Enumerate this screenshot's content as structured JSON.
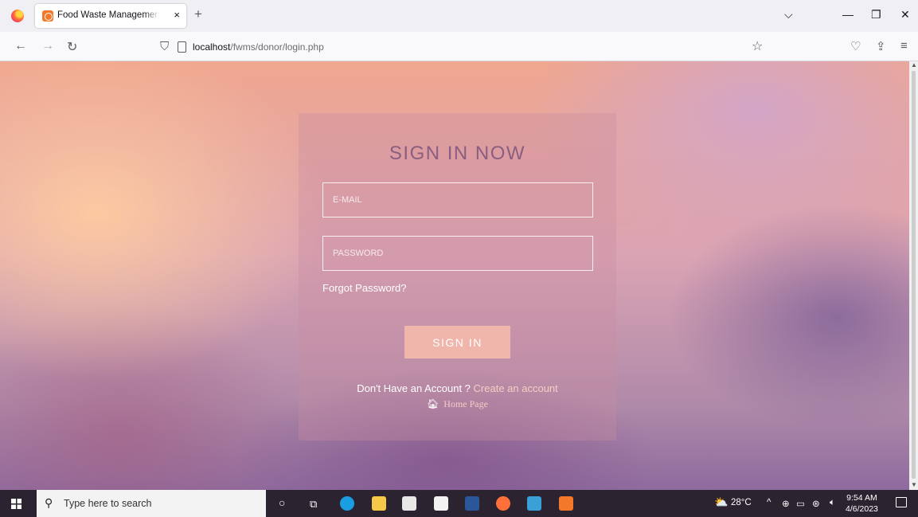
{
  "browser": {
    "tab_title": "Food Waste Management Syste",
    "new_tab": "+",
    "tab_close": "×",
    "url_host": "localhost",
    "url_path": "/fwms/donor/login.php"
  },
  "login": {
    "title": "SIGN IN NOW",
    "email_placeholder": "E-MAIL",
    "password_placeholder": "PASSWORD",
    "forgot_password": "Forgot Password?",
    "sign_in_button": "SIGN IN",
    "no_account_text": "Don't Have an Account ?",
    "create_account_link": "Create an account",
    "home_page_link": "Home Page"
  },
  "taskbar": {
    "search_placeholder": "Type here to search",
    "weather": "28°C",
    "time": "9:54 AM",
    "date": "4/6/2023"
  },
  "colors": {
    "accent_button": "#f0b5ab",
    "title_color": "#8a5e80",
    "link_color": "#f6cdc4"
  },
  "icons": [
    "firefox-icon",
    "search-icon",
    "shield-icon",
    "star-icon",
    "home-icon",
    "windows-start-icon"
  ]
}
